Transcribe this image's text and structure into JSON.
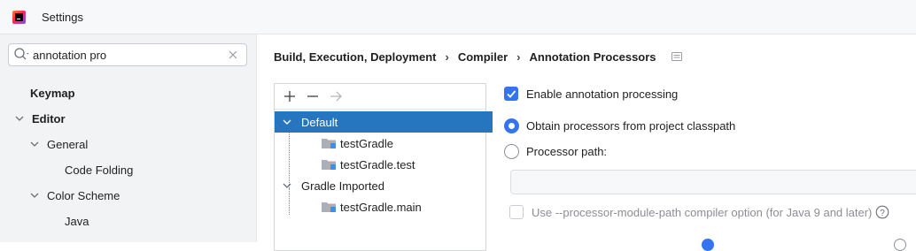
{
  "window": {
    "title": "Settings",
    "logo_icon": "intellij-idea-logo-icon"
  },
  "search": {
    "value": "annotation pro",
    "icon": "search-icon",
    "clear_icon": "close-icon"
  },
  "sidebar": {
    "items": [
      {
        "label": "Keymap"
      },
      {
        "label": "Editor"
      },
      {
        "label": "General"
      },
      {
        "label": "Code Folding"
      },
      {
        "label": "Color Scheme"
      },
      {
        "label": "Java"
      }
    ]
  },
  "breadcrumb": {
    "items": [
      "Build, Execution, Deployment",
      "Compiler",
      "Annotation Processors"
    ],
    "separator": "›"
  },
  "processors": {
    "toolbar": {
      "add_icon": "plus-icon",
      "remove_icon": "minus-icon",
      "move_icon": "arrow-right-icon"
    },
    "tree": [
      {
        "label": "Default"
      },
      {
        "label": "testGradle"
      },
      {
        "label": "testGradle.test"
      },
      {
        "label": "Gradle Imported"
      },
      {
        "label": "testGradle.main"
      }
    ]
  },
  "options": {
    "enable_processing": {
      "label": "Enable annotation processing",
      "checked": true
    },
    "obtain_classpath": {
      "label": "Obtain processors from project classpath",
      "selected": true
    },
    "processor_path": {
      "label": "Processor path:",
      "selected": false,
      "value": ""
    },
    "module_path": {
      "label": "Use --processor-module-path compiler option (for Java 9 and later)",
      "checked": false,
      "enabled": false
    }
  },
  "colors": {
    "accent": "#3574f0",
    "selection": "#2675bf",
    "sidebar_bg": "#f2f3f5"
  }
}
